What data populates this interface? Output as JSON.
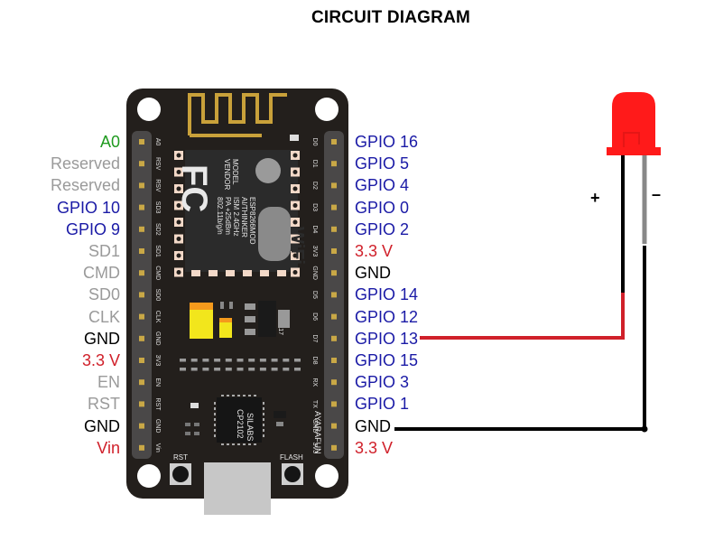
{
  "title": "CIRCUIT DIAGRAM",
  "colors": {
    "gpio": "#1a1aa6",
    "power": "#d0202a",
    "ground": "#000000",
    "reserved": "#9a9a9a",
    "analog": "#1f9a1f",
    "board": "#231f1c",
    "wire_red": "#d0202a",
    "wire_black": "#000000",
    "led": "#ff1a1a"
  },
  "board": {
    "module_text": [
      "MODEL",
      "VENDOR",
      "ESP8266MOD",
      "AI/THINKER",
      "ISM 2.4GHz",
      "PA +25dBm",
      "802.11b/g/n"
    ],
    "fcc_mark": "FC",
    "wifi_mark": "WiFi",
    "regulator": "AM1117",
    "usb_chip": [
      "SILABS",
      "CP2102"
    ],
    "brand": "AYARAFUN",
    "buttons": [
      "RST",
      "FLASH"
    ]
  },
  "left_pins": [
    {
      "silk": "A0",
      "label": "A0",
      "type": "analog"
    },
    {
      "silk": "RSV",
      "label": "Reserved",
      "type": "reserved"
    },
    {
      "silk": "RSV",
      "label": "Reserved",
      "type": "reserved"
    },
    {
      "silk": "SD3",
      "label": "GPIO 10",
      "type": "gpio"
    },
    {
      "silk": "SD2",
      "label": "GPIO 9",
      "type": "gpio"
    },
    {
      "silk": "SD1",
      "label": "SD1",
      "type": "reserved"
    },
    {
      "silk": "CMD",
      "label": "CMD",
      "type": "reserved"
    },
    {
      "silk": "SD0",
      "label": "SD0",
      "type": "reserved"
    },
    {
      "silk": "CLK",
      "label": "CLK",
      "type": "reserved"
    },
    {
      "silk": "GND",
      "label": "GND",
      "type": "ground"
    },
    {
      "silk": "3V3",
      "label": "3.3 V",
      "type": "power"
    },
    {
      "silk": "EN",
      "label": "EN",
      "type": "reserved"
    },
    {
      "silk": "RST",
      "label": "RST",
      "type": "reserved"
    },
    {
      "silk": "GND",
      "label": "GND",
      "type": "ground"
    },
    {
      "silk": "Vin",
      "label": "Vin",
      "type": "power"
    }
  ],
  "right_pins": [
    {
      "silk": "D0",
      "label": "GPIO 16",
      "type": "gpio"
    },
    {
      "silk": "D1",
      "label": "GPIO 5",
      "type": "gpio"
    },
    {
      "silk": "D2",
      "label": "GPIO 4",
      "type": "gpio"
    },
    {
      "silk": "D3",
      "label": "GPIO 0",
      "type": "gpio"
    },
    {
      "silk": "D4",
      "label": "GPIO 2",
      "type": "gpio"
    },
    {
      "silk": "3V3",
      "label": "3.3 V",
      "type": "power"
    },
    {
      "silk": "GND",
      "label": "GND",
      "type": "ground"
    },
    {
      "silk": "D5",
      "label": "GPIO 14",
      "type": "gpio"
    },
    {
      "silk": "D6",
      "label": "GPIO 12",
      "type": "gpio"
    },
    {
      "silk": "D7",
      "label": "GPIO 13",
      "type": "gpio"
    },
    {
      "silk": "D8",
      "label": "GPIO 15",
      "type": "gpio"
    },
    {
      "silk": "RX",
      "label": "GPIO 3",
      "type": "gpio"
    },
    {
      "silk": "TX",
      "label": "GPIO 1",
      "type": "gpio"
    },
    {
      "silk": "GND",
      "label": "GND",
      "type": "ground"
    },
    {
      "silk": "3V3",
      "label": "3.3 V",
      "type": "power"
    }
  ],
  "led": {
    "anode_label": "+",
    "cathode_label": "–"
  },
  "connections": [
    {
      "from": "GPIO 13",
      "to": "LED anode (+)",
      "wire": "red"
    },
    {
      "from": "GND",
      "to": "LED cathode (–)",
      "wire": "black"
    }
  ]
}
